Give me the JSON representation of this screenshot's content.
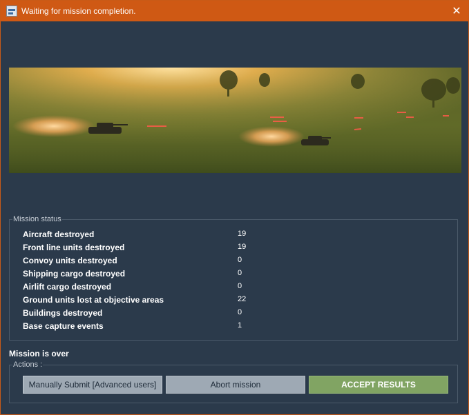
{
  "window": {
    "title": "Waiting for mission completion.",
    "close_glyph": "✕",
    "app_icon": "app-logo-icon"
  },
  "banner": {
    "description_icon": "tank-battle-banner"
  },
  "mission_status": {
    "group_label": "Mission status",
    "rows": [
      {
        "label": "Aircraft destroyed",
        "value": "19"
      },
      {
        "label": "Front line units destroyed",
        "value": "19"
      },
      {
        "label": "Convoy units destroyed",
        "value": "0"
      },
      {
        "label": "Shipping cargo destroyed",
        "value": "0"
      },
      {
        "label": "Airlift cargo destroyed",
        "value": "0"
      },
      {
        "label": "Ground units lost at objective areas",
        "value": "22"
      },
      {
        "label": "Buildings destroyed",
        "value": "0"
      },
      {
        "label": "Base capture events",
        "value": "1"
      }
    ]
  },
  "mission_over_text": "Mission is over",
  "actions": {
    "group_label": "Actions :",
    "manual_submit_label": "Manually Submit [Advanced users]",
    "abort_label": "Abort mission",
    "accept_label": "ACCEPT RESULTS"
  },
  "colors": {
    "titlebar": "#cf5914",
    "background": "#2b3a4b",
    "accept_button": "#81a463",
    "secondary_button": "#9ea9b4"
  }
}
